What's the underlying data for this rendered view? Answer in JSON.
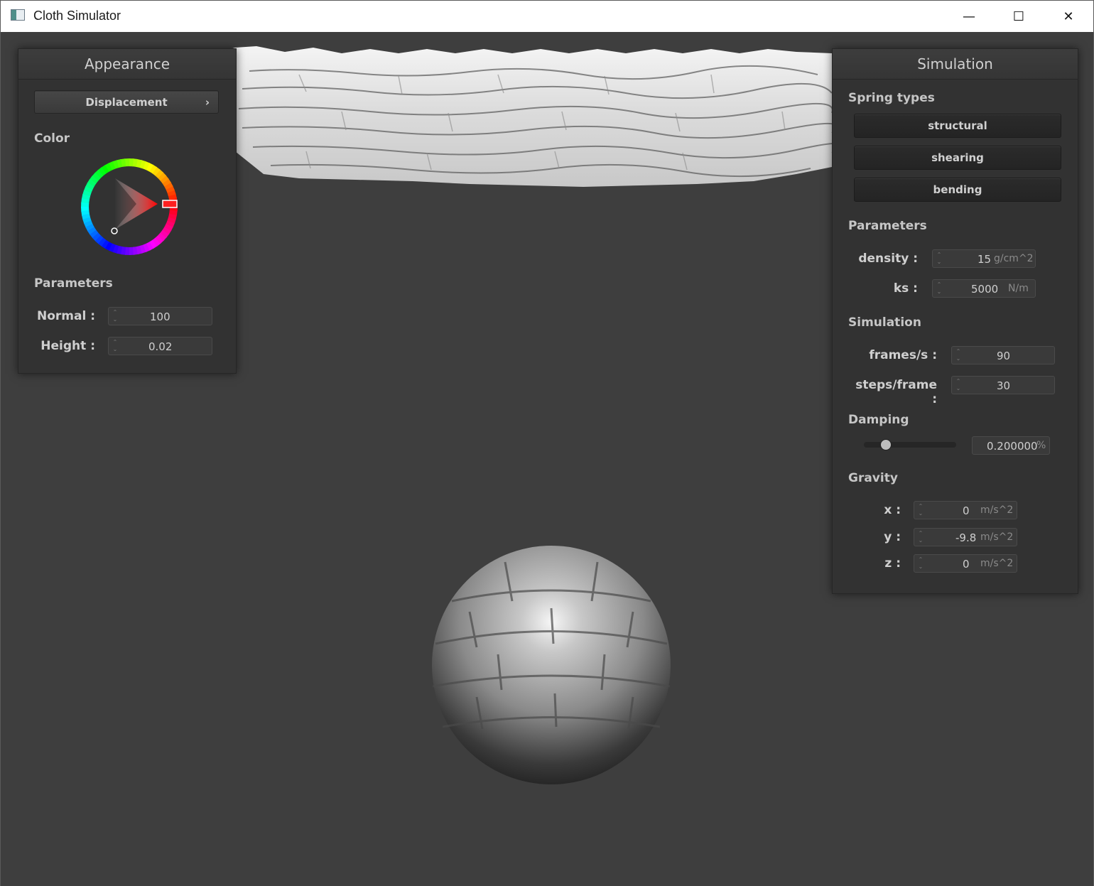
{
  "window": {
    "title": "Cloth Simulator",
    "minimize_glyph": "—",
    "maximize_glyph": "☐",
    "close_glyph": "✕"
  },
  "appearance": {
    "title": "Appearance",
    "shader_button": "Displacement",
    "shader_chevron": "›",
    "color_label": "Color",
    "selected_color": "#ff0000",
    "parameters_label": "Parameters",
    "normal": {
      "label": "Normal :",
      "value": "100"
    },
    "height": {
      "label": "Height :",
      "value": "0.02"
    }
  },
  "simulation": {
    "title": "Simulation",
    "spring_types_label": "Spring types",
    "spring_buttons": [
      "structural",
      "shearing",
      "bending"
    ],
    "parameters_label": "Parameters",
    "density": {
      "label": "density :",
      "value": "15",
      "unit": "g/cm^2"
    },
    "ks": {
      "label": "ks :",
      "value": "5000",
      "unit": "N/m"
    },
    "simulation_label": "Simulation",
    "fps": {
      "label": "frames/s :",
      "value": "90"
    },
    "steps": {
      "label": "steps/frame :",
      "value": "30"
    },
    "damping_label": "Damping",
    "damping": {
      "value": "0.200000",
      "unit": "%",
      "slider_fraction": 0.2
    },
    "gravity_label": "Gravity",
    "gravity_x": {
      "label": "x :",
      "value": "0",
      "unit": "m/s^2"
    },
    "gravity_y": {
      "label": "y :",
      "value": "-9.8",
      "unit": "m/s^2"
    },
    "gravity_z": {
      "label": "z :",
      "value": "0",
      "unit": "m/s^2"
    }
  },
  "icons": {
    "app": "app-window-icon",
    "spinner": "spinner-arrows-icon"
  }
}
